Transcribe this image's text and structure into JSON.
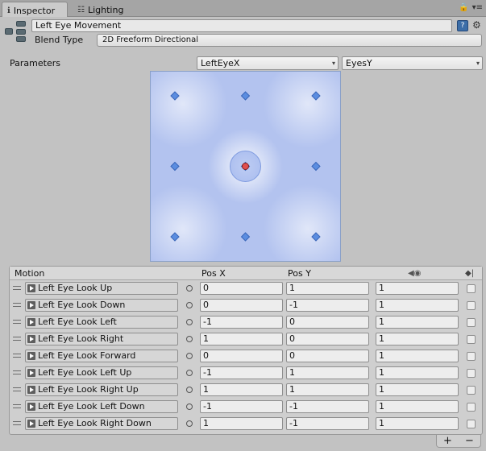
{
  "tabs": [
    {
      "icon": "info-icon",
      "label": "Inspector"
    },
    {
      "icon": "lighting-icon",
      "label": "Lighting"
    }
  ],
  "header": {
    "name_value": "Left Eye Movement",
    "blend_type_label": "Blend Type",
    "blend_type_value": "2D Freeform Directional"
  },
  "parameters": {
    "label": "Parameters",
    "x_param": "LeftEyeX",
    "y_param": "EyesY"
  },
  "blend_graph": {
    "motion_points": [
      {
        "x": -1,
        "y": 1
      },
      {
        "x": 0,
        "y": 1
      },
      {
        "x": 1,
        "y": 1
      },
      {
        "x": -1,
        "y": 0
      },
      {
        "x": 1,
        "y": 0
      },
      {
        "x": -1,
        "y": -1
      },
      {
        "x": 0,
        "y": -1
      },
      {
        "x": 1,
        "y": -1
      }
    ],
    "center_point": {
      "x": 0,
      "y": 0
    },
    "point_color": "#5b8de0",
    "active_color": "#e05050"
  },
  "table": {
    "headers": {
      "motion": "Motion",
      "pos_x": "Pos X",
      "pos_y": "Pos Y"
    },
    "rows": [
      {
        "motion": "Left Eye Look Up",
        "pos_x": "0",
        "pos_y": "1",
        "speed": "1"
      },
      {
        "motion": "Left Eye Look Down",
        "pos_x": "0",
        "pos_y": "-1",
        "speed": "1"
      },
      {
        "motion": "Left Eye Look Left",
        "pos_x": "-1",
        "pos_y": "0",
        "speed": "1"
      },
      {
        "motion": "Left Eye Look Right",
        "pos_x": "1",
        "pos_y": "0",
        "speed": "1"
      },
      {
        "motion": "Left Eye Look Forward",
        "pos_x": "0",
        "pos_y": "0",
        "speed": "1"
      },
      {
        "motion": "Left Eye Look Left Up",
        "pos_x": "-1",
        "pos_y": "1",
        "speed": "1"
      },
      {
        "motion": "Left Eye Look Right Up",
        "pos_x": "1",
        "pos_y": "1",
        "speed": "1"
      },
      {
        "motion": "Left Eye Look Left Down",
        "pos_x": "-1",
        "pos_y": "-1",
        "speed": "1"
      },
      {
        "motion": "Left Eye Look Right Down",
        "pos_x": "1",
        "pos_y": "-1",
        "speed": "1"
      }
    ]
  },
  "footer": {
    "add": "+",
    "remove": "−"
  }
}
